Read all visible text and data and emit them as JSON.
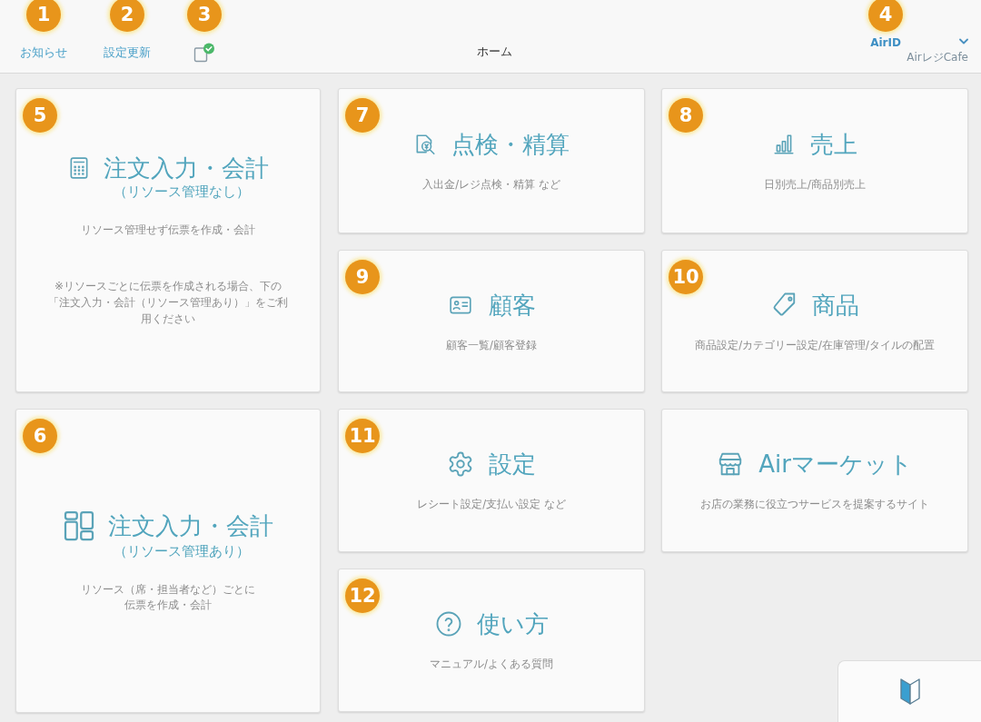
{
  "header": {
    "left_items": [
      {
        "kind": "link",
        "label": "お知らせ",
        "badge": "1"
      },
      {
        "kind": "link",
        "label": "設定更新",
        "badge": "2"
      },
      {
        "kind": "icon",
        "badge": "3"
      }
    ],
    "title": "ホーム",
    "account": {
      "label": "AirID",
      "store": "AirレジCafe",
      "badge": "4"
    }
  },
  "left_column": [
    {
      "badge": "5",
      "title": "注文入力・会計",
      "subtitle": "（リソース管理なし）",
      "description": "リソース管理せず伝票を作成・会計",
      "note": "※リソースごとに伝票を作成される場合、下の「注文入力・会計（リソース管理あり）」をご利用ください"
    },
    {
      "badge": "6",
      "title": "注文入力・会計",
      "subtitle": "（リソース管理あり）",
      "description": "リソース（席・担当者など）ごとに伝票を作成・会計"
    }
  ],
  "grid": [
    {
      "badge": "7",
      "title": "点検・精算",
      "description": "入出金/レジ点検・精算 など"
    },
    {
      "badge": "8",
      "title": "売上",
      "description": "日別売上/商品別売上"
    },
    {
      "badge": "9",
      "title": "顧客",
      "description": "顧客一覧/顧客登録"
    },
    {
      "badge": "10",
      "title": "商品",
      "description": "商品設定/カテゴリー設定/在庫管理/タイルの配置"
    },
    {
      "badge": "11",
      "title": "設定",
      "description": "レシート設定/支払い設定 など"
    },
    {
      "title": "Airマーケット",
      "description": "お店の業務に役立つサービスを提案するサイト"
    },
    {
      "badge": "12",
      "title": "使い方",
      "description": "マニュアル/よくある質問"
    }
  ]
}
